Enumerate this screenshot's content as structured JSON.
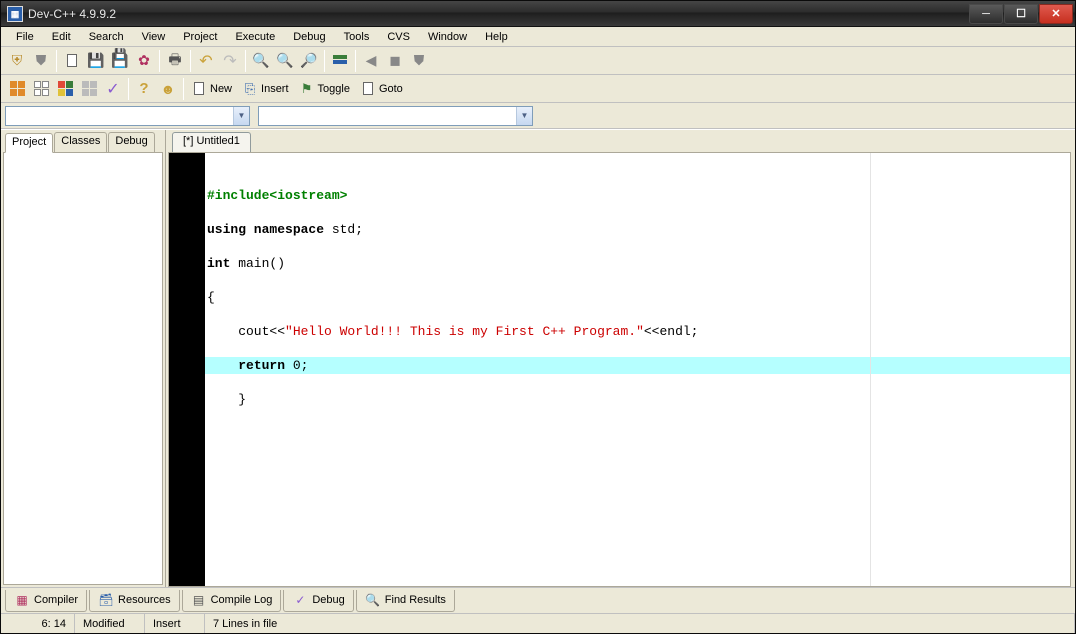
{
  "window": {
    "title": "Dev-C++ 4.9.9.2"
  },
  "menu": {
    "file": "File",
    "edit": "Edit",
    "search": "Search",
    "view": "View",
    "project": "Project",
    "execute": "Execute",
    "debug": "Debug",
    "tools": "Tools",
    "cvs": "CVS",
    "window_m": "Window",
    "help": "Help"
  },
  "toolbar2": {
    "new": "New",
    "insert": "Insert",
    "toggle": "Toggle",
    "goto": "Goto"
  },
  "side_tabs": {
    "project": "Project",
    "classes": "Classes",
    "debug": "Debug"
  },
  "doc_tab": "[*] Untitled1",
  "code": {
    "l1a": "#include",
    "l1b": "<iostream>",
    "l2a": "using namespace",
    "l2b": " std;",
    "l3a": "int",
    "l3b": " main()",
    "l4": "{",
    "l5a": "    cout<<",
    "l5b": "\"Hello World!!! This is my First C++ Program.\"",
    "l5c": "<<endl;",
    "l6a": "    ",
    "l6b": "return",
    "l6c": " 0;",
    "l7": "    }"
  },
  "bottom_tabs": {
    "compiler": "Compiler",
    "resources": "Resources",
    "compile_log": "Compile Log",
    "debug": "Debug",
    "find_results": "Find Results"
  },
  "status": {
    "pos": "6: 14",
    "modified": "Modified",
    "insert": "Insert",
    "lines": "7 Lines in file"
  }
}
